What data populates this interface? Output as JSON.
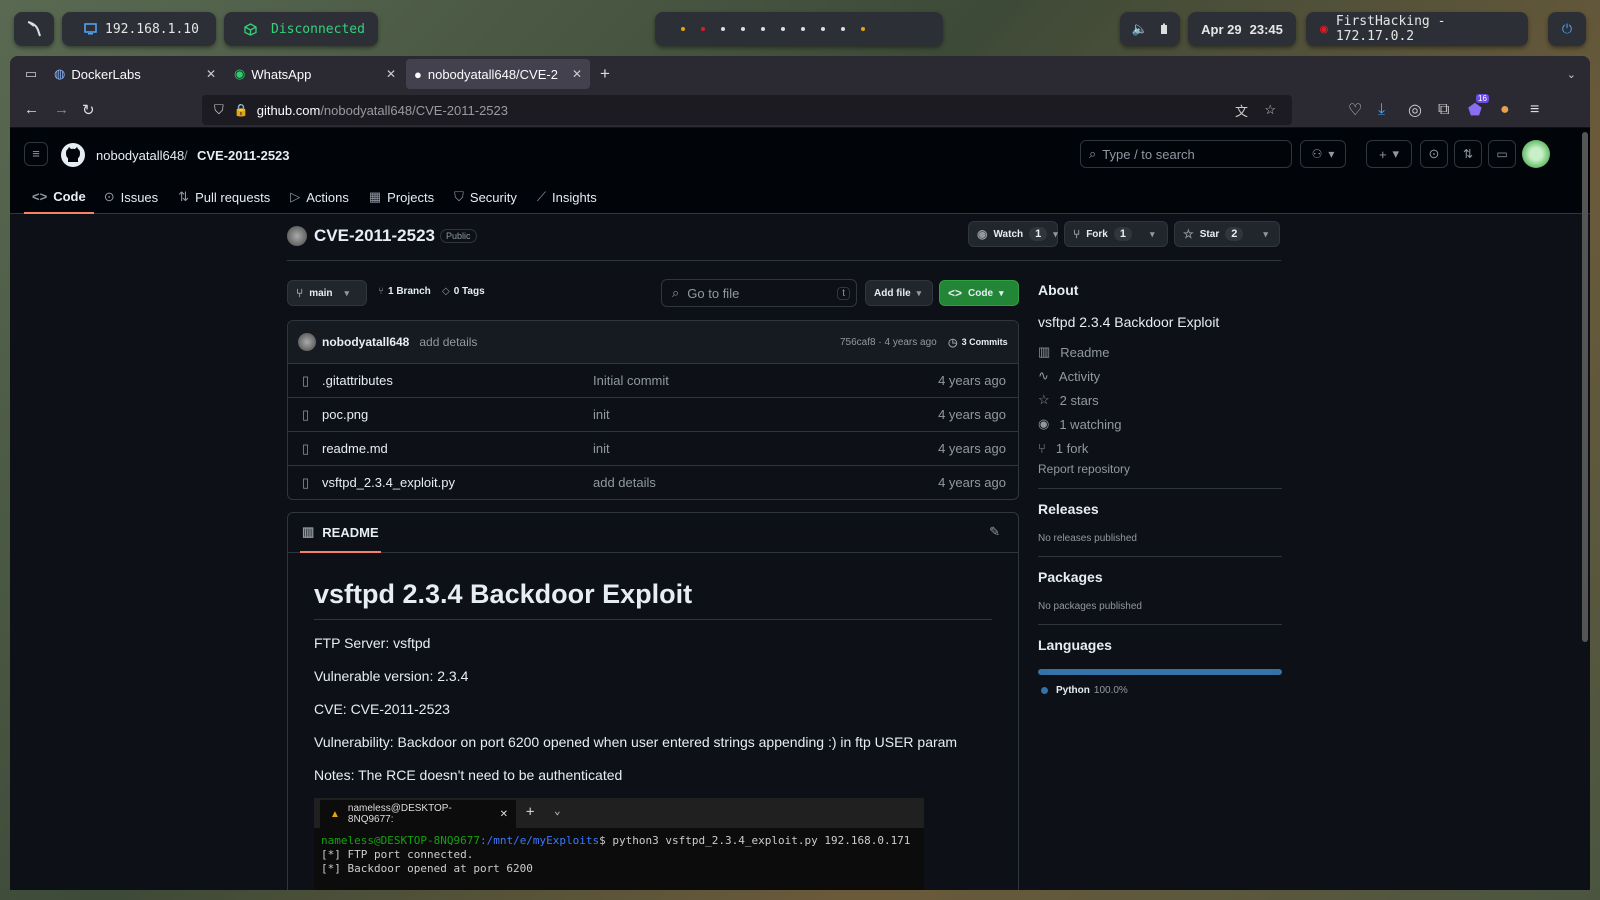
{
  "system": {
    "ip_local": "192.168.1.10",
    "vpn_status": "Disconnected",
    "date": "Apr 29",
    "time": "23:45",
    "target": "FirstHacking - 172.17.0.2"
  },
  "browser": {
    "tabs": [
      {
        "label": "DockerLabs"
      },
      {
        "label": "WhatsApp"
      },
      {
        "label": "nobodyatall648/CVE-201"
      }
    ],
    "url_host": "github.com",
    "url_path": "/nobodyatall648/CVE-2011-2523",
    "extension_badge": "16"
  },
  "github": {
    "owner": "nobodyatall648",
    "repo": "CVE-2011-2523",
    "search_placeholder": "Type / to search",
    "nav": [
      "Code",
      "Issues",
      "Pull requests",
      "Actions",
      "Projects",
      "Security",
      "Insights"
    ],
    "visibility": "Public",
    "watch": {
      "label": "Watch",
      "count": "1"
    },
    "fork": {
      "label": "Fork",
      "count": "1"
    },
    "star": {
      "label": "Star",
      "count": "2"
    },
    "branch": "main",
    "branches": "1 Branch",
    "tags": "0 Tags",
    "goto_placeholder": "Go to file",
    "goto_key": "t",
    "add_file": "Add file",
    "code_btn": "Code",
    "last_commit": {
      "author": "nobodyatall648",
      "message": "add details",
      "hash_time": "756caf8 · 4 years ago",
      "commits": "3 Commits"
    },
    "files": [
      {
        "name": ".gitattributes",
        "msg": "Initial commit",
        "time": "4 years ago"
      },
      {
        "name": "poc.png",
        "msg": "init",
        "time": "4 years ago"
      },
      {
        "name": "readme.md",
        "msg": "init",
        "time": "4 years ago"
      },
      {
        "name": "vsftpd_2.3.4_exploit.py",
        "msg": "add details",
        "time": "4 years ago"
      }
    ],
    "readme": {
      "tab": "README",
      "title": "vsftpd 2.3.4 Backdoor Exploit",
      "lines": [
        "FTP Server: vsftpd",
        "Vulnerable version: 2.3.4",
        "CVE: CVE-2011-2523",
        "Vulnerability: Backdoor on port 6200 opened when user entered strings appending :) in ftp USER param",
        "Notes: The RCE doesn't need to be authenticated"
      ],
      "terminal": {
        "tab": "nameless@DESKTOP-8NQ9677:",
        "prompt_user": "nameless@DESKTOP-8NQ9677",
        "prompt_path": ":/mnt/e/myExploits",
        "command": "$ python3 vsftpd_2.3.4_exploit.py 192.168.0.171",
        "out1": "[*] FTP port connected.",
        "out2": "[*] Backdoor opened at port 6200"
      }
    },
    "about": {
      "heading": "About",
      "desc": "vsftpd 2.3.4 Backdoor Exploit",
      "items": [
        "Readme",
        "Activity",
        "2 stars",
        "1 watching",
        "1 fork"
      ],
      "report": "Report repository",
      "releases_h": "Releases",
      "releases_txt": "No releases published",
      "packages_h": "Packages",
      "packages_txt": "No packages published",
      "languages_h": "Languages",
      "lang_name": "Python",
      "lang_pct": "100.0%",
      "lang_share": 1.0,
      "lang_color": "#3572A5"
    }
  }
}
